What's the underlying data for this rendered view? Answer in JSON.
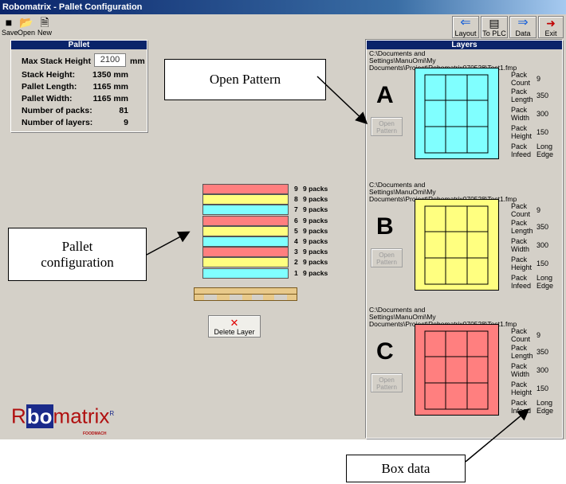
{
  "window": {
    "title": "Robomatrix - Pallet Configuration"
  },
  "toolbar": {
    "left": [
      {
        "label": "Save",
        "icon": "save-icon"
      },
      {
        "label": "Open",
        "icon": "open-folder-icon"
      },
      {
        "label": "New",
        "icon": "new-file-icon"
      }
    ],
    "right": [
      {
        "label": "Layout",
        "icon": "arrow-left-icon"
      },
      {
        "label": "To PLC",
        "icon": "plc-icon"
      },
      {
        "label": "Data",
        "icon": "arrow-right-icon"
      },
      {
        "label": "Exit",
        "icon": "exit-door-icon"
      }
    ]
  },
  "pallet": {
    "heading": "Pallet",
    "max_stack_height_label": "Max Stack Height",
    "max_stack_height_value": "2100",
    "max_stack_height_unit": "mm",
    "rows": [
      {
        "label": "Stack Height:",
        "value": "1350 mm"
      },
      {
        "label": "Pallet Length:",
        "value": "1165 mm"
      },
      {
        "label": "Pallet Width:",
        "value": "1165 mm"
      },
      {
        "label": "Number of packs:",
        "value": "81"
      },
      {
        "label": "Number of layers:",
        "value": "9"
      }
    ]
  },
  "stack": {
    "layers": [
      {
        "num": "9",
        "packs": "9 packs",
        "color": "#ff7f7f"
      },
      {
        "num": "8",
        "packs": "9 packs",
        "color": "#ffff80"
      },
      {
        "num": "7",
        "packs": "9 packs",
        "color": "#80ffff"
      },
      {
        "num": "6",
        "packs": "9 packs",
        "color": "#ff7f7f"
      },
      {
        "num": "5",
        "packs": "9 packs",
        "color": "#ffff80"
      },
      {
        "num": "4",
        "packs": "9 packs",
        "color": "#80ffff"
      },
      {
        "num": "3",
        "packs": "9 packs",
        "color": "#ff7f7f"
      },
      {
        "num": "2",
        "packs": "9 packs",
        "color": "#ffff80"
      },
      {
        "num": "1",
        "packs": "9 packs",
        "color": "#80ffff"
      }
    ],
    "delete_label": "Delete Layer"
  },
  "layers_panel": {
    "heading": "Layers",
    "items": [
      {
        "letter": "A",
        "path": "C:\\Documents and Settings\\ManuOmi\\My Documents\\Project\\Robomatrix070528\\Test1.fmp",
        "color": "#80ffff",
        "button": "Open Pattern",
        "count_label": "Pack Count",
        "count": "9",
        "length_label": "Pack Length",
        "length": "350",
        "width_label": "Pack Width",
        "width": "300",
        "height_label": "Pack Height",
        "height": "150",
        "infeed_label": "Pack Infeed",
        "infeed": "Long Edge"
      },
      {
        "letter": "B",
        "path": "C:\\Documents and Settings\\ManuOmi\\My Documents\\Project\\Robomatrix070528\\Test1.fmp",
        "color": "#ffff80",
        "button": "Open Pattern",
        "count_label": "Pack Count",
        "count": "9",
        "length_label": "Pack Length",
        "length": "350",
        "width_label": "Pack Width",
        "width": "300",
        "height_label": "Pack Height",
        "height": "150",
        "infeed_label": "Pack Infeed",
        "infeed": "Long Edge"
      },
      {
        "letter": "C",
        "path": "C:\\Documents and Settings\\ManuOmi\\My Documents\\Project\\Robomatrix070528\\Test1.fmp",
        "color": "#ff7f7f",
        "button": "Open Pattern",
        "count_label": "Pack Count",
        "count": "9",
        "length_label": "Pack Length",
        "length": "350",
        "width_label": "Pack Width",
        "width": "300",
        "height_label": "Pack Height",
        "height": "150",
        "infeed_label": "Pack Infeed",
        "infeed": "Long Edge"
      }
    ]
  },
  "callouts": {
    "open_pattern": "Open Pattern",
    "pallet_configuration_1": "Pallet",
    "pallet_configuration_2": "configuration",
    "box_data": "Box data"
  },
  "logo": {
    "text_r": "R",
    "text_bo": "bo",
    "text_rest": "matrix",
    "mark": "R",
    "sub": "FOODMACH"
  }
}
